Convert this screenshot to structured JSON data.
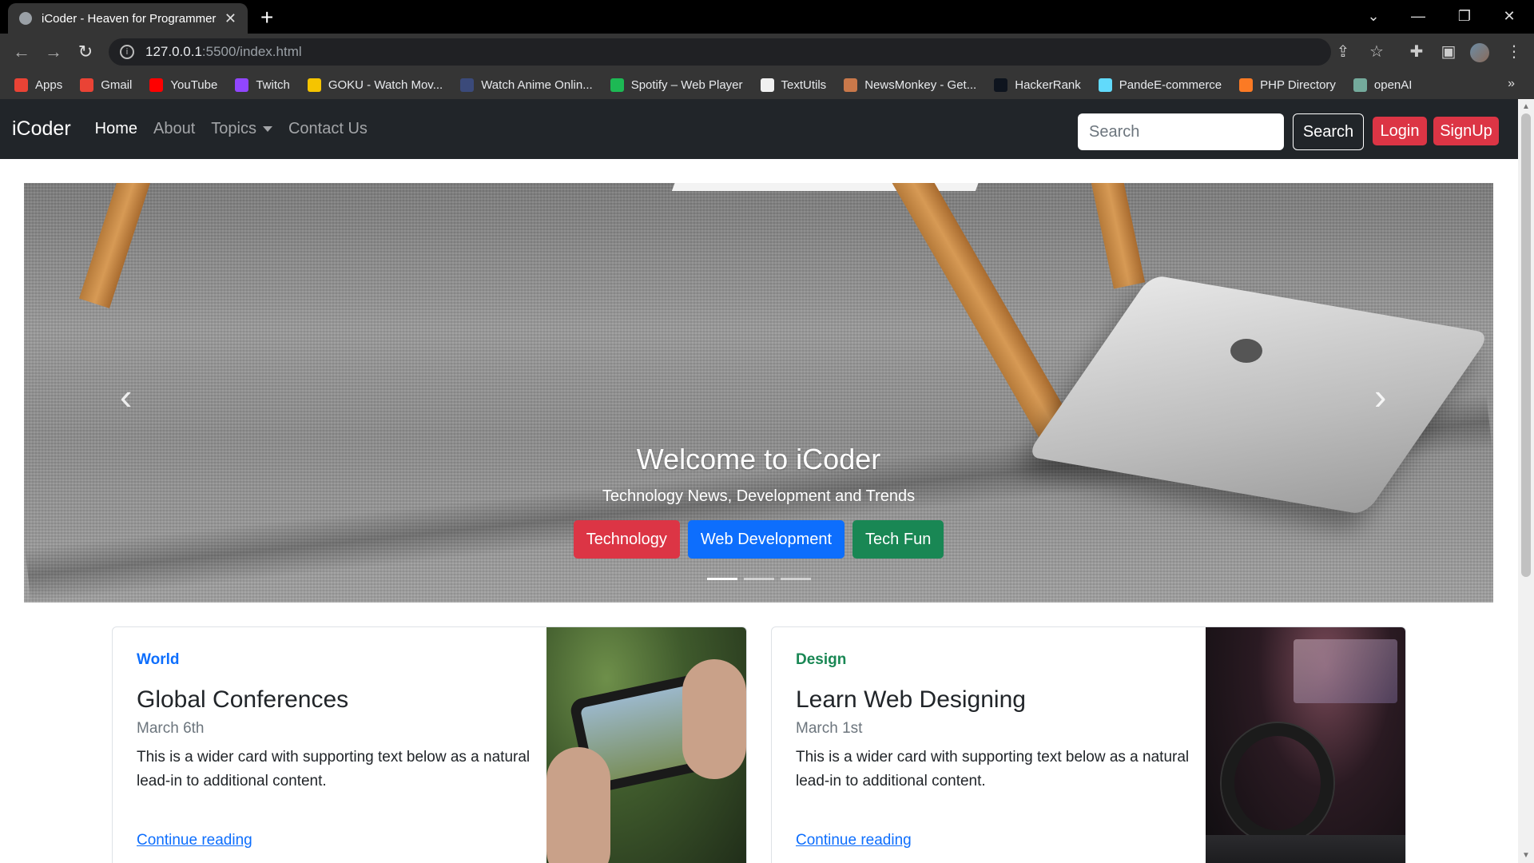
{
  "browser": {
    "tab_title": "iCoder - Heaven for Programmers",
    "url_host": "127.0.0.1",
    "url_path": ":5500/index.html",
    "bookmarks": [
      {
        "label": "Apps",
        "icon": "apps-grid-icon",
        "color": "#ea4335"
      },
      {
        "label": "Gmail",
        "icon": "gmail-icon",
        "color": "#ea4335"
      },
      {
        "label": "YouTube",
        "icon": "youtube-icon",
        "color": "#ff0000"
      },
      {
        "label": "Twitch",
        "icon": "twitch-icon",
        "color": "#9146ff"
      },
      {
        "label": "GOKU - Watch Mov...",
        "icon": "goku-icon",
        "color": "#f5c400"
      },
      {
        "label": "Watch Anime Onlin...",
        "icon": "anime-icon",
        "color": "#3b4a7a"
      },
      {
        "label": "Spotify – Web Player",
        "icon": "spotify-icon",
        "color": "#1db954"
      },
      {
        "label": "TextUtils",
        "icon": "textutils-icon",
        "color": "#f0f0f0"
      },
      {
        "label": "NewsMonkey - Get...",
        "icon": "newsmonkey-icon",
        "color": "#c9784a"
      },
      {
        "label": "HackerRank",
        "icon": "hackerrank-icon",
        "color": "#0e141e"
      },
      {
        "label": "PandeE-commerce",
        "icon": "react-icon",
        "color": "#61dafb"
      },
      {
        "label": "PHP Directory",
        "icon": "xampp-icon",
        "color": "#fb7a24"
      },
      {
        "label": "openAI",
        "icon": "openai-icon",
        "color": "#74aa9c"
      }
    ]
  },
  "navbar": {
    "brand": "iCoder",
    "links": [
      "Home",
      "About",
      "Topics",
      "Contact Us"
    ],
    "search_placeholder": "Search",
    "search_button": "Search",
    "login": "Login",
    "signup": "SignUp"
  },
  "carousel": {
    "title": "Welcome to iCoder",
    "subtitle": "Technology News, Development and Trends",
    "buttons": [
      {
        "label": "Technology",
        "color": "#dc3545"
      },
      {
        "label": "Web Development",
        "color": "#0d6efd"
      },
      {
        "label": "Tech Fun",
        "color": "#198754"
      }
    ],
    "indicator_count": 3,
    "active_index": 0
  },
  "cards": [
    {
      "category": "World",
      "category_color": "#0d6efd",
      "title": "Global Conferences",
      "date": "March 6th",
      "text": "This is a wider card with supporting text below as a natural lead-in to additional content.",
      "link": "Continue reading"
    },
    {
      "category": "Design",
      "category_color": "#198754",
      "title": "Learn Web Designing",
      "date": "March 1st",
      "text": "This is a wider card with supporting text below as a natural lead-in to additional content.",
      "link": "Continue reading"
    }
  ]
}
